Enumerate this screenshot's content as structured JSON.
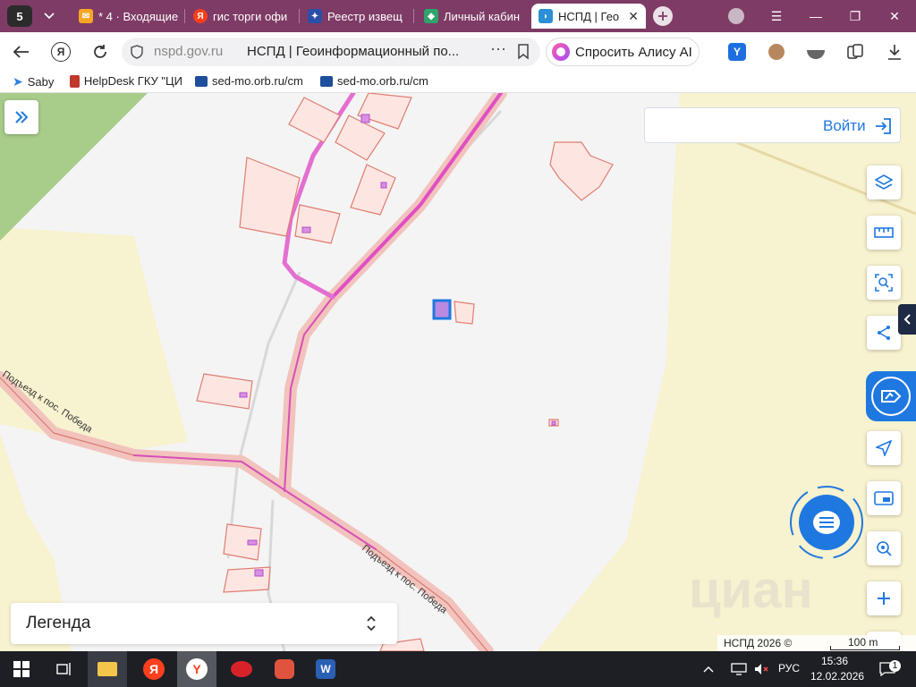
{
  "browser": {
    "tab_counter": "5",
    "tabs": [
      {
        "label": "* 4 · Входящие"
      },
      {
        "label": "гис торги офи"
      },
      {
        "label": "Реестр извещ"
      },
      {
        "label": "Личный кабин"
      },
      {
        "label": "НСПД | Гео"
      }
    ],
    "url_domain": "nspd.gov.ru",
    "page_title": "НСПД | Геоинформационный по...",
    "alisa_label": "Спросить Алису AI",
    "bookmarks": [
      {
        "label": "Saby"
      },
      {
        "label": "HelpDesk ГКУ \"ЦИ"
      },
      {
        "label": "sed-mo.orb.ru/cm"
      },
      {
        "label": "sed-mo.orb.ru/cm"
      }
    ]
  },
  "map": {
    "login_label": "Войти",
    "legend_label": "Легенда",
    "road_labels": [
      "Подъезд к пос. Победа",
      "Подъезд к пос. Победа"
    ],
    "copyright": "НСПД 2026 ©",
    "scale_label": "100 m",
    "watermark": "циан"
  },
  "taskbar": {
    "language": "РУС",
    "time": "15:36",
    "date": "12.02.2026",
    "notification_count": "1"
  }
}
